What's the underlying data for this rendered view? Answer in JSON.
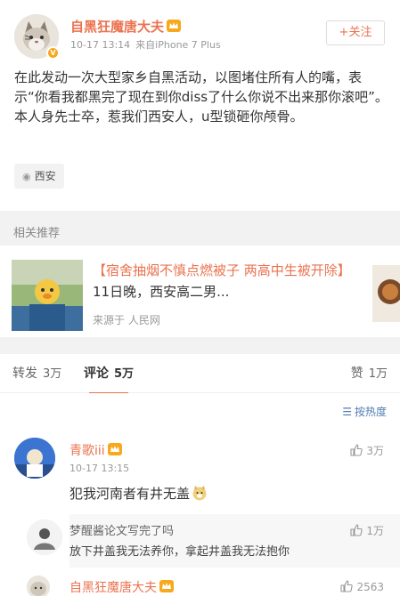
{
  "post": {
    "author": "自黑狂魔唐大夫",
    "time": "10-17 13:14",
    "source": "来自iPhone 7 Plus",
    "follow_label": "+关注",
    "text_lines": [
      "在此发动一次大型家乡自黑活动，以图堵住所有人的嘴，表示“你看我都黑完了现在到你diss了什么你说不出来那你滚吧”。",
      "本人身先士卒，惹我们西安人，u型锁砸你颅骨。"
    ],
    "location": "西安"
  },
  "related": {
    "section_title": "相关推荐",
    "headline_highlight": "【宿舍抽烟不慎点燃被子 两高中生被开除】",
    "headline_rest": "11日晚，西安高二男...",
    "source": "来源于 人民网"
  },
  "tabs": {
    "repost_label": "转发",
    "repost_count": "3万",
    "comment_label": "评论",
    "comment_count": "5万",
    "like_label": "赞",
    "like_count": "1万"
  },
  "sort": {
    "label": "按热度"
  },
  "comments": [
    {
      "name": "青歌iii",
      "time": "10-17 13:15",
      "likes": "3万",
      "text": "犯我河南者有井无盖",
      "reply": {
        "name": "梦醒酱论文写完了吗",
        "text": "放下井盖我无法养你，拿起井盖我无法抱你",
        "likes": "1万"
      }
    },
    {
      "name": "自黑狂魔唐大夫",
      "likes": "2563"
    }
  ],
  "colors": {
    "accent": "#eb7350",
    "link": "#507daf",
    "badge": "#f7a81b"
  }
}
